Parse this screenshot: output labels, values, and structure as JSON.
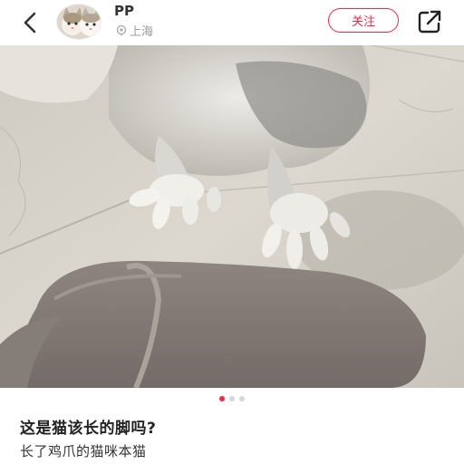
{
  "header": {
    "username": "PP",
    "location": "上海",
    "follow_label": "关注",
    "icons": {
      "back": "chevron-left-icon",
      "location": "location-pin-icon",
      "share": "share-icon"
    }
  },
  "carousel": {
    "total": 3,
    "active_index": 0
  },
  "post": {
    "title": "这是猫该长的脚吗?",
    "description": "长了鸡爪的猫咪本猫"
  },
  "colors": {
    "accent": "#ff2442",
    "text_primary": "#222222",
    "text_secondary": "#999999"
  }
}
